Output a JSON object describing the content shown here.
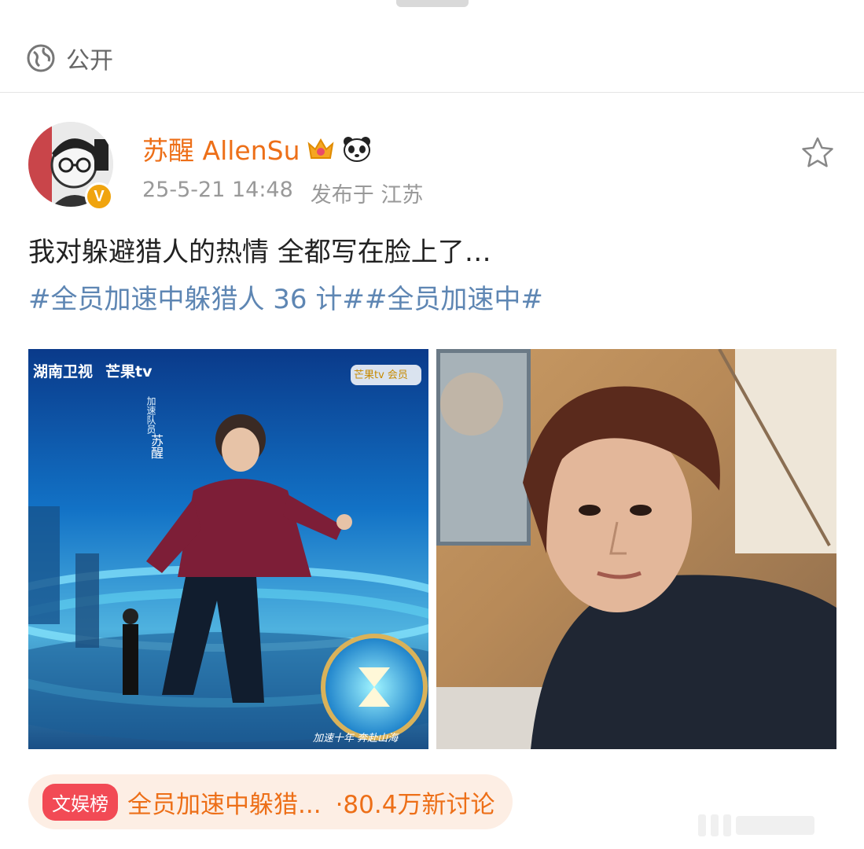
{
  "header": {
    "visibility_icon": "globe-icon",
    "visibility_label": "公开"
  },
  "post": {
    "author": {
      "name": "苏醒 AllenSu",
      "badges": [
        "crown-icon",
        "panda-icon"
      ],
      "verified_icon": "verified-badge-icon",
      "verified_letter": "V"
    },
    "timestamp": "25-5-21 14:48",
    "location": "发布于 江苏",
    "favorite_icon": "star-outline-icon",
    "text": "我对躲避猎人的热情 全都写在脸上了…",
    "hashtags": "#全员加速中躲猎人 36 计##全员加速中#",
    "photos": [
      {
        "logo_left": "湖南卫视",
        "logo_mid": "芒果tv",
        "logo_right": "芒果tv 会员",
        "caption_small": "加速队员",
        "caption_name": "苏醒",
        "bottom_text": "加速十年 奔赴山海"
      },
      {
        "description_icon": "selfie-photo"
      }
    ]
  },
  "trend": {
    "badge": "文娱榜",
    "title": "全员加速中躲猎...",
    "meta": "·80.4万新讨论"
  },
  "colors": {
    "accent_name": "#ed6f18",
    "hashtag": "#5e86b3",
    "muted": "#999999",
    "trend_badge": "#f24a55",
    "trend_bg": "#fdeee4"
  }
}
